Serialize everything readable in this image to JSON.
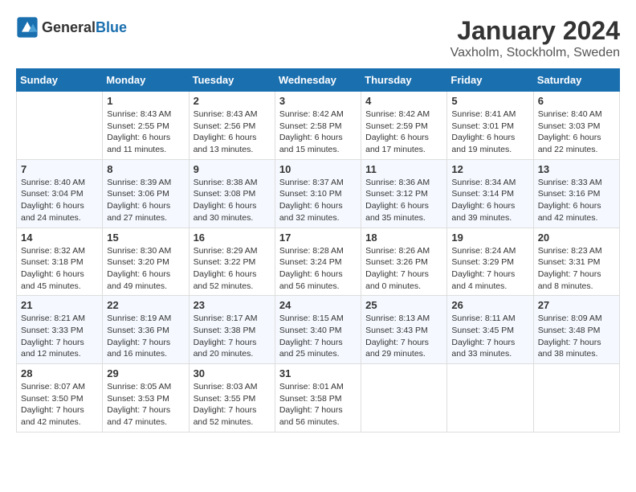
{
  "header": {
    "logo_general": "General",
    "logo_blue": "Blue",
    "month": "January 2024",
    "location": "Vaxholm, Stockholm, Sweden"
  },
  "weekdays": [
    "Sunday",
    "Monday",
    "Tuesday",
    "Wednesday",
    "Thursday",
    "Friday",
    "Saturday"
  ],
  "weeks": [
    [
      {
        "day": "",
        "info": ""
      },
      {
        "day": "1",
        "info": "Sunrise: 8:43 AM\nSunset: 2:55 PM\nDaylight: 6 hours\nand 11 minutes."
      },
      {
        "day": "2",
        "info": "Sunrise: 8:43 AM\nSunset: 2:56 PM\nDaylight: 6 hours\nand 13 minutes."
      },
      {
        "day": "3",
        "info": "Sunrise: 8:42 AM\nSunset: 2:58 PM\nDaylight: 6 hours\nand 15 minutes."
      },
      {
        "day": "4",
        "info": "Sunrise: 8:42 AM\nSunset: 2:59 PM\nDaylight: 6 hours\nand 17 minutes."
      },
      {
        "day": "5",
        "info": "Sunrise: 8:41 AM\nSunset: 3:01 PM\nDaylight: 6 hours\nand 19 minutes."
      },
      {
        "day": "6",
        "info": "Sunrise: 8:40 AM\nSunset: 3:03 PM\nDaylight: 6 hours\nand 22 minutes."
      }
    ],
    [
      {
        "day": "7",
        "info": "Sunrise: 8:40 AM\nSunset: 3:04 PM\nDaylight: 6 hours\nand 24 minutes."
      },
      {
        "day": "8",
        "info": "Sunrise: 8:39 AM\nSunset: 3:06 PM\nDaylight: 6 hours\nand 27 minutes."
      },
      {
        "day": "9",
        "info": "Sunrise: 8:38 AM\nSunset: 3:08 PM\nDaylight: 6 hours\nand 30 minutes."
      },
      {
        "day": "10",
        "info": "Sunrise: 8:37 AM\nSunset: 3:10 PM\nDaylight: 6 hours\nand 32 minutes."
      },
      {
        "day": "11",
        "info": "Sunrise: 8:36 AM\nSunset: 3:12 PM\nDaylight: 6 hours\nand 35 minutes."
      },
      {
        "day": "12",
        "info": "Sunrise: 8:34 AM\nSunset: 3:14 PM\nDaylight: 6 hours\nand 39 minutes."
      },
      {
        "day": "13",
        "info": "Sunrise: 8:33 AM\nSunset: 3:16 PM\nDaylight: 6 hours\nand 42 minutes."
      }
    ],
    [
      {
        "day": "14",
        "info": "Sunrise: 8:32 AM\nSunset: 3:18 PM\nDaylight: 6 hours\nand 45 minutes."
      },
      {
        "day": "15",
        "info": "Sunrise: 8:30 AM\nSunset: 3:20 PM\nDaylight: 6 hours\nand 49 minutes."
      },
      {
        "day": "16",
        "info": "Sunrise: 8:29 AM\nSunset: 3:22 PM\nDaylight: 6 hours\nand 52 minutes."
      },
      {
        "day": "17",
        "info": "Sunrise: 8:28 AM\nSunset: 3:24 PM\nDaylight: 6 hours\nand 56 minutes."
      },
      {
        "day": "18",
        "info": "Sunrise: 8:26 AM\nSunset: 3:26 PM\nDaylight: 7 hours\nand 0 minutes."
      },
      {
        "day": "19",
        "info": "Sunrise: 8:24 AM\nSunset: 3:29 PM\nDaylight: 7 hours\nand 4 minutes."
      },
      {
        "day": "20",
        "info": "Sunrise: 8:23 AM\nSunset: 3:31 PM\nDaylight: 7 hours\nand 8 minutes."
      }
    ],
    [
      {
        "day": "21",
        "info": "Sunrise: 8:21 AM\nSunset: 3:33 PM\nDaylight: 7 hours\nand 12 minutes."
      },
      {
        "day": "22",
        "info": "Sunrise: 8:19 AM\nSunset: 3:36 PM\nDaylight: 7 hours\nand 16 minutes."
      },
      {
        "day": "23",
        "info": "Sunrise: 8:17 AM\nSunset: 3:38 PM\nDaylight: 7 hours\nand 20 minutes."
      },
      {
        "day": "24",
        "info": "Sunrise: 8:15 AM\nSunset: 3:40 PM\nDaylight: 7 hours\nand 25 minutes."
      },
      {
        "day": "25",
        "info": "Sunrise: 8:13 AM\nSunset: 3:43 PM\nDaylight: 7 hours\nand 29 minutes."
      },
      {
        "day": "26",
        "info": "Sunrise: 8:11 AM\nSunset: 3:45 PM\nDaylight: 7 hours\nand 33 minutes."
      },
      {
        "day": "27",
        "info": "Sunrise: 8:09 AM\nSunset: 3:48 PM\nDaylight: 7 hours\nand 38 minutes."
      }
    ],
    [
      {
        "day": "28",
        "info": "Sunrise: 8:07 AM\nSunset: 3:50 PM\nDaylight: 7 hours\nand 42 minutes."
      },
      {
        "day": "29",
        "info": "Sunrise: 8:05 AM\nSunset: 3:53 PM\nDaylight: 7 hours\nand 47 minutes."
      },
      {
        "day": "30",
        "info": "Sunrise: 8:03 AM\nSunset: 3:55 PM\nDaylight: 7 hours\nand 52 minutes."
      },
      {
        "day": "31",
        "info": "Sunrise: 8:01 AM\nSunset: 3:58 PM\nDaylight: 7 hours\nand 56 minutes."
      },
      {
        "day": "",
        "info": ""
      },
      {
        "day": "",
        "info": ""
      },
      {
        "day": "",
        "info": ""
      }
    ]
  ]
}
